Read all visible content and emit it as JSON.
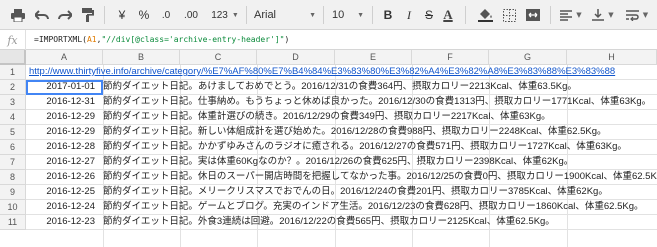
{
  "toolbar": {
    "currency": "¥",
    "percent": "%",
    "decimal_less": ".0",
    "decimal_more": ".00",
    "more_formats": "123",
    "font": "Arial",
    "font_size": "10",
    "bold": "B",
    "italic": "I",
    "strike": "S",
    "text_color": "A"
  },
  "formula_bar": {
    "fx": "fx",
    "part1": "=IMPORTXML(",
    "ref": "A1",
    "part2": ",",
    "xpath": "\"//div[@class='archive-entry-header']\"",
    "part3": ")"
  },
  "columns": [
    "A",
    "B",
    "C",
    "D",
    "E",
    "F",
    "G",
    "H"
  ],
  "rows": [
    {
      "num": "1",
      "date": "",
      "text": "http://www.thirtyfive.info/archive/category/%E7%AF%80%E7%B4%84%E3%83%80%E3%82%A4%E3%82%A8%E3%83%88%E3%83%88"
    },
    {
      "num": "2",
      "date": "2017-01-01",
      "text": "節約ダイエット日記。あけましておめでとう。2016/12/31の食費364円、摂取カロリー2213Kcal、体重63.5Kg。"
    },
    {
      "num": "3",
      "date": "2016-12-31",
      "text": "節約ダイエット日記。仕事納め。もうちょっと休めば良かった。2016/12/30の食費1313円、摂取カロリー1771Kcal、体重63Kg。"
    },
    {
      "num": "4",
      "date": "2016-12-29",
      "text": "節約ダイエット日記。体重計選びの続き。2016/12/29の食費349円、摂取カロリー2217Kcal、体重63Kg。"
    },
    {
      "num": "5",
      "date": "2016-12-29",
      "text": "節約ダイエット日記。新しい体組成計を選び始めた。2016/12/28の食費988円、摂取カロリー2248Kcal、体重62.5Kg。"
    },
    {
      "num": "6",
      "date": "2016-12-28",
      "text": "節約ダイエット日記。かかずゆみさんのラジオに癒される。2016/12/27の食費571円、摂取カロリー1727Kcal、体重63Kg。"
    },
    {
      "num": "7",
      "date": "2016-12-27",
      "text": "節約ダイエット日記。実は体重60Kgなのか？。2016/12/26の食費625円、摂取カロリー2398Kcal、体重62Kg。"
    },
    {
      "num": "8",
      "date": "2016-12-26",
      "text": "節約ダイエット日記。休日のスーパー開店時間を把握してなかった事。2016/12/25の食費0円、摂取カロリー1900Kcal、体重62.5Kg。"
    },
    {
      "num": "9",
      "date": "2016-12-25",
      "text": "節約ダイエット日記。メリークリスマスでおでんの日。2016/12/24の食費201円、摂取カロリー3785Kcal、体重62Kg。"
    },
    {
      "num": "10",
      "date": "2016-12-24",
      "text": "節約ダイエット日記。ゲームとブログ。充実のインドア生活。2016/12/23の食費628円、摂取カロリー1860Kcal、体重62.5Kg。"
    },
    {
      "num": "11",
      "date": "2016-12-23",
      "text": "節約ダイエット日記。外食3連続は回避。2016/12/22の食費565円、摂取カロリー2125Kcal、体重62.5Kg。"
    }
  ]
}
